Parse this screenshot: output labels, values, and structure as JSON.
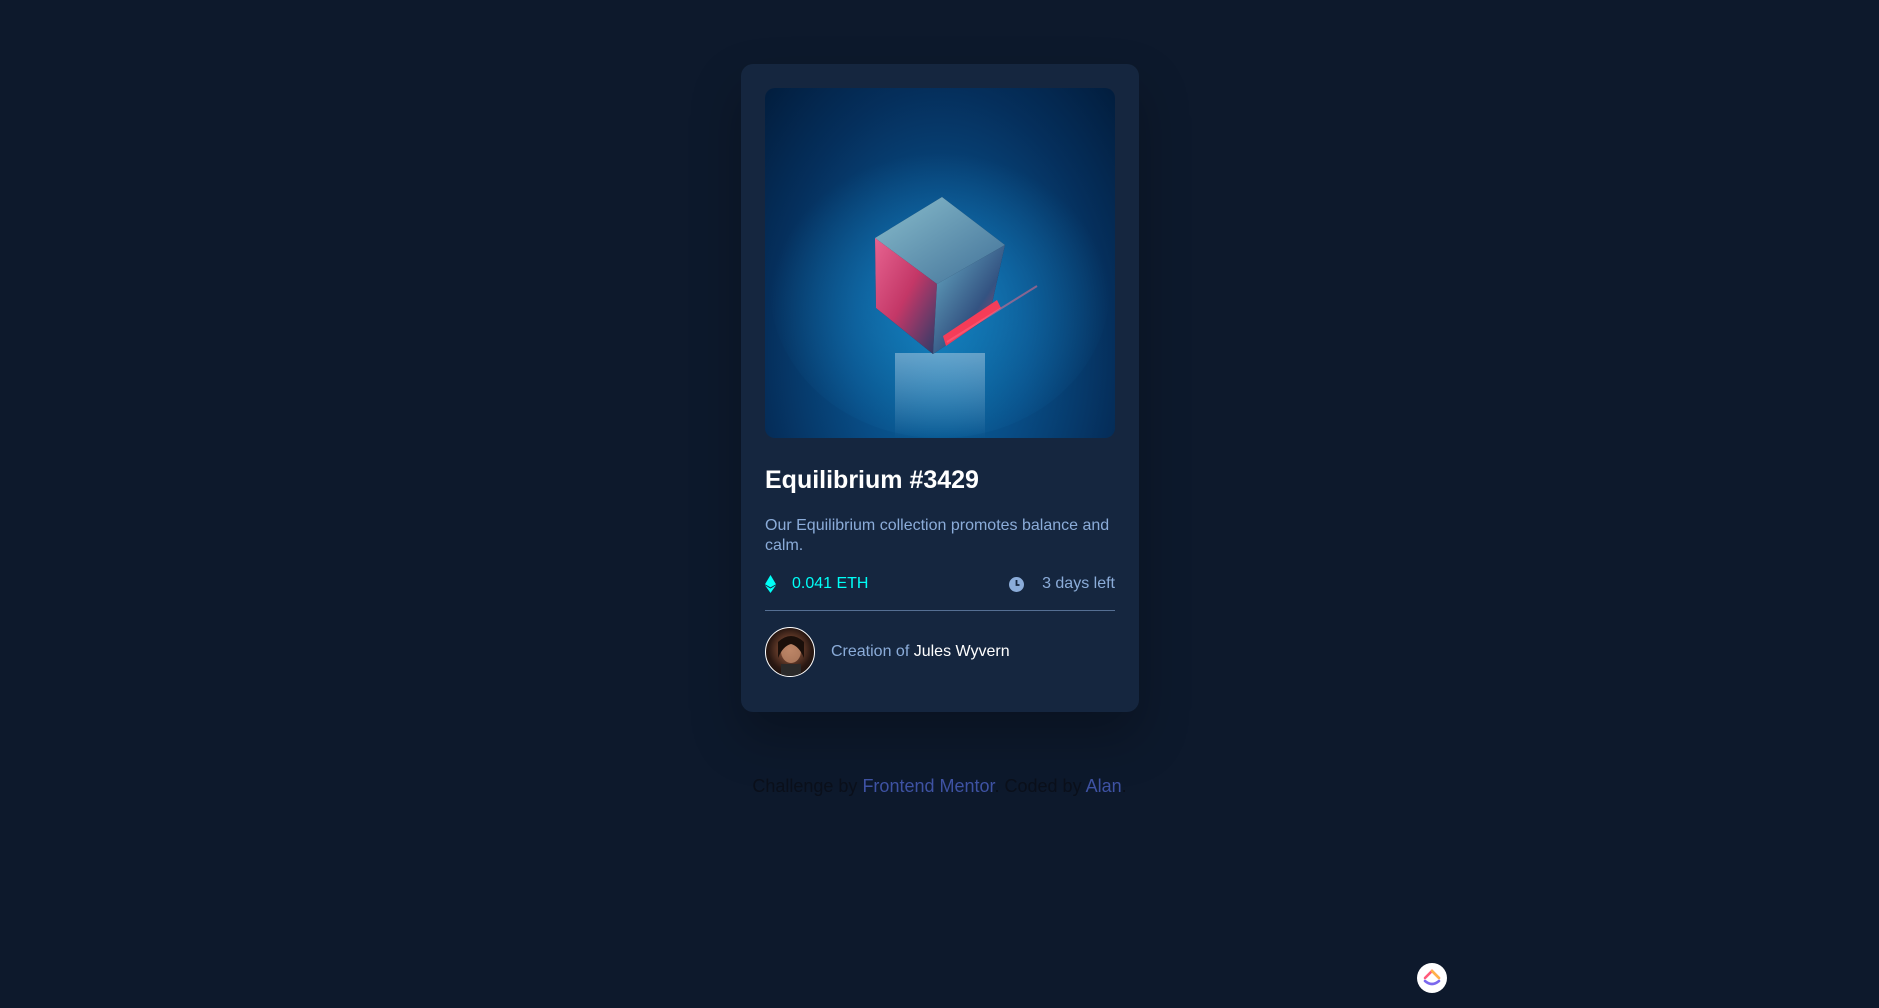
{
  "card": {
    "image_alt": "equilibrium cube",
    "title": "Equilibrium #3429",
    "description": "Our Equilibrium collection promotes balance and calm.",
    "price": "0.041 ETH",
    "time_left": "3 days left",
    "creator_prefix": "Creation of ",
    "creator_name": "Jules Wyvern"
  },
  "attribution": {
    "challenge_prefix": "Challenge by ",
    "challenge_link": "Frontend Mentor",
    "separator": ". Coded by ",
    "author_link": "Alan",
    "suffix": "."
  },
  "icons": {
    "eth": "ethereum-icon",
    "clock": "clock-icon",
    "fab": "clickup-icon"
  },
  "colors": {
    "page_bg": "#0d192c",
    "card_bg": "#15263f",
    "cyan": "#00fff7",
    "soft_blue": "#8bacd9",
    "white": "#ffffff",
    "link": "#3e52a3"
  }
}
